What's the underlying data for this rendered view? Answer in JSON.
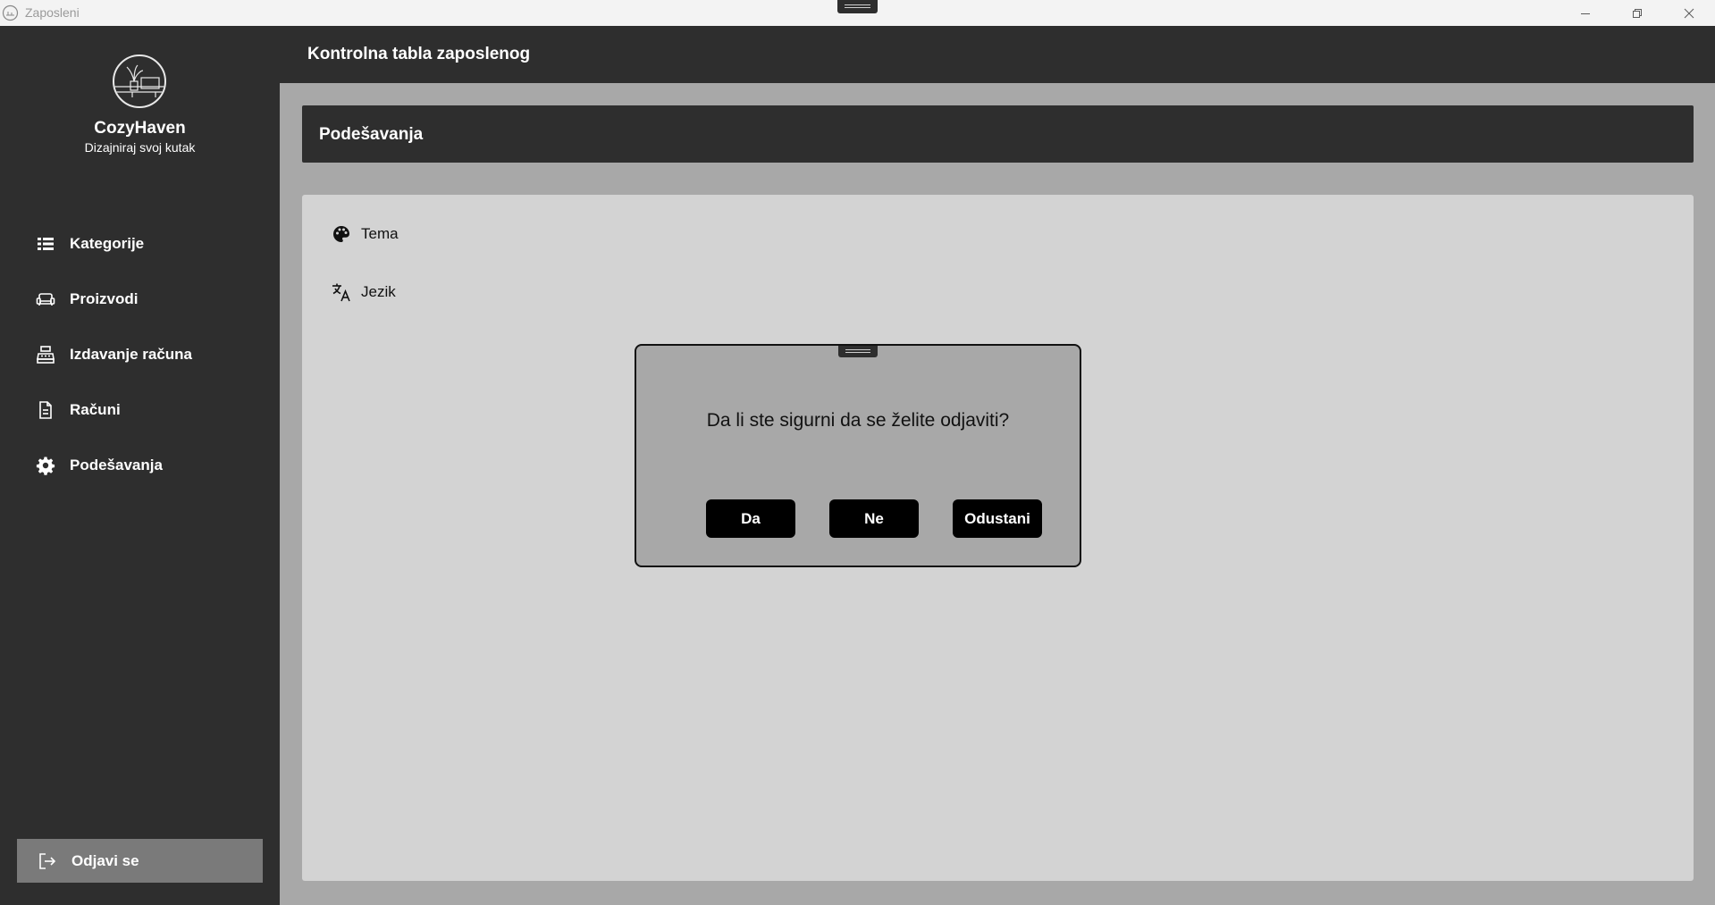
{
  "window": {
    "title": "Zaposleni",
    "controls": [
      "minimize-icon",
      "restore-icon",
      "close-icon"
    ]
  },
  "sidebar": {
    "brand": "CozyHaven",
    "tagline": "Dizajniraj svoj kutak",
    "items": [
      {
        "label": "Kategorije",
        "icon": "list-icon"
      },
      {
        "label": "Proizvodi",
        "icon": "sofa-icon"
      },
      {
        "label": "Izdavanje računa",
        "icon": "cash-register-icon"
      },
      {
        "label": "Računi",
        "icon": "document-icon"
      },
      {
        "label": "Podešavanja",
        "icon": "gear-icon"
      }
    ],
    "logout": {
      "label": "Odjavi se",
      "icon": "logout-icon"
    }
  },
  "header": {
    "title": "Kontrolna tabla zaposlenog"
  },
  "section": {
    "title": "Podešavanja"
  },
  "settings": [
    {
      "label": "Tema",
      "icon": "palette-icon"
    },
    {
      "label": "Jezik",
      "icon": "translate-icon"
    }
  ],
  "dialog": {
    "message": "Da li ste sigurni da se želite odjaviti?",
    "buttons": {
      "yes": "Da",
      "no": "Ne",
      "cancel": "Odustani"
    }
  },
  "colors": {
    "sidebar_bg": "#2e2e2e",
    "content_bg": "#d3d3d3",
    "page_bg": "#a8a8a8",
    "logout_bg": "#7a7a7a",
    "dialog_button_bg": "#000000"
  }
}
